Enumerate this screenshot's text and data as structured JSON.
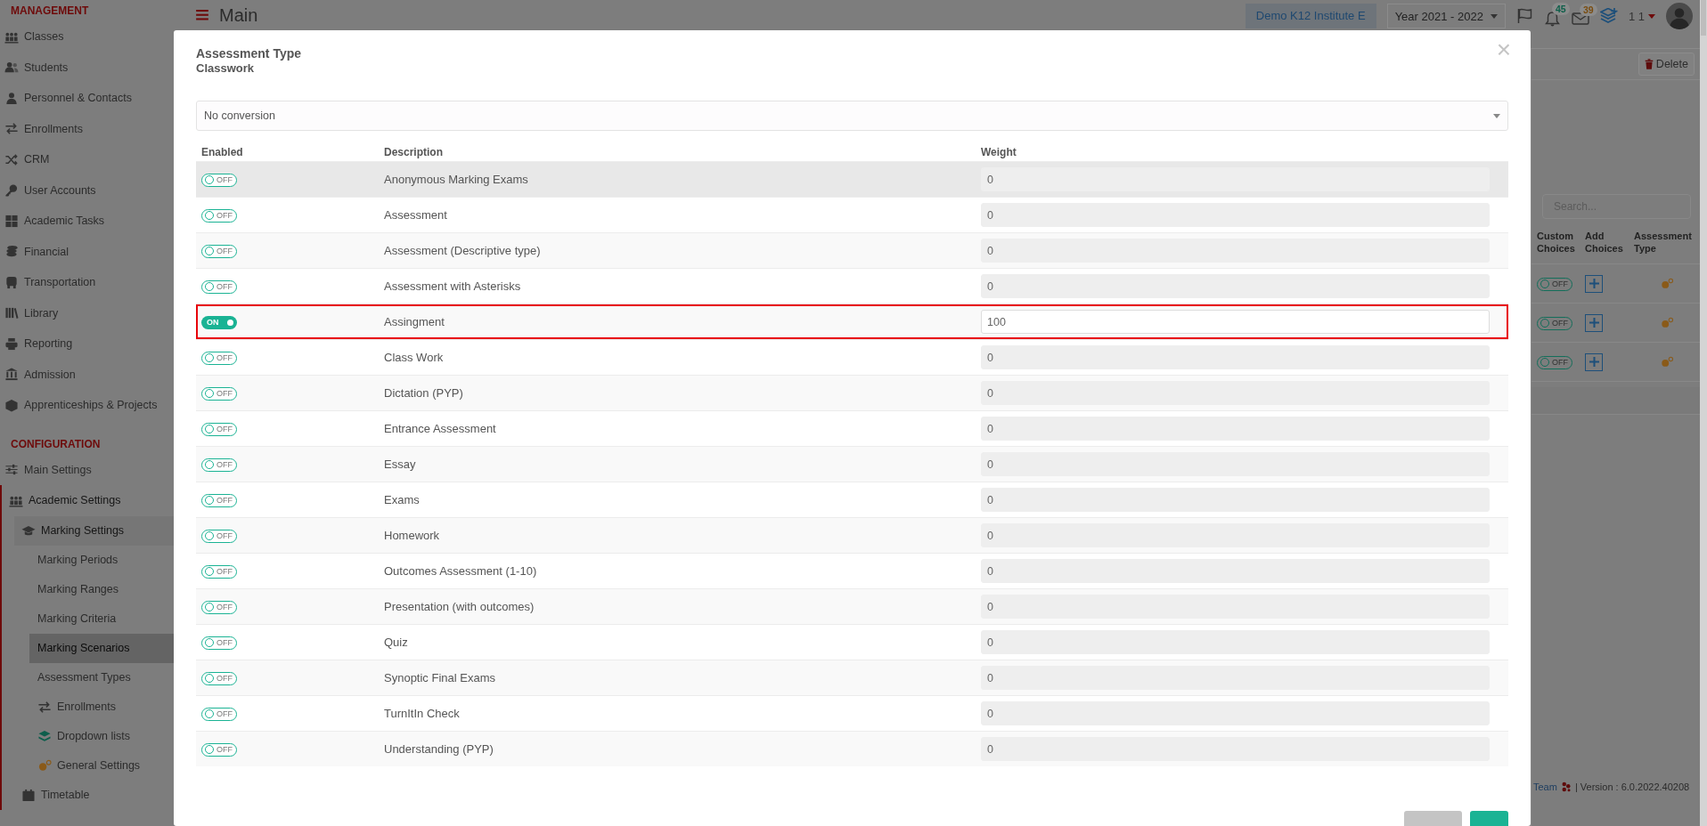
{
  "sidebar": {
    "sections": [
      {
        "title": "MANAGEMENT",
        "items": [
          {
            "label": "Classes",
            "kind": "people",
            "selected": false
          },
          {
            "label": "Students",
            "kind": "users",
            "selected": false
          },
          {
            "label": "Personnel & Contacts",
            "kind": "user",
            "selected": false
          },
          {
            "label": "Enrollments",
            "kind": "arrows",
            "selected": false
          },
          {
            "label": "CRM",
            "kind": "shuffle",
            "selected": false
          },
          {
            "label": "User Accounts",
            "kind": "key",
            "selected": false
          },
          {
            "label": "Academic Tasks",
            "kind": "grid",
            "selected": false
          },
          {
            "label": "Financial",
            "kind": "coins",
            "selected": false
          },
          {
            "label": "Transportation",
            "kind": "bus",
            "selected": false
          },
          {
            "label": "Library",
            "kind": "books",
            "selected": false
          },
          {
            "label": "Reporting",
            "kind": "printer",
            "selected": false
          },
          {
            "label": "Admission",
            "kind": "bank",
            "selected": false
          },
          {
            "label": "Apprenticeships & Projects",
            "kind": "cube",
            "selected": false
          }
        ]
      },
      {
        "title": "CONFIGURATION",
        "items": [
          {
            "label": "Main Settings",
            "kind": "sliders",
            "selected": false
          },
          {
            "label": "Academic Settings",
            "kind": "people",
            "selected": false,
            "expanded": true,
            "children": [
              {
                "label": "Marking Settings",
                "kind": "graduation-cap",
                "selected": false,
                "expanded": true,
                "children": [
                  {
                    "label": "Marking Periods",
                    "selected": false
                  },
                  {
                    "label": "Marking Ranges",
                    "selected": false
                  },
                  {
                    "label": "Marking Criteria",
                    "selected": false
                  },
                  {
                    "label": "Marking Scenarios",
                    "selected": true
                  },
                  {
                    "label": "Assessment Types",
                    "selected": false
                  },
                  {
                    "label": "Enrollments",
                    "kind": "arrows",
                    "selected": false
                  },
                  {
                    "label": "Dropdown lists",
                    "kind": "layers",
                    "selected": false
                  },
                  {
                    "label": "General Settings",
                    "kind": "gears",
                    "selected": false
                  }
                ]
              },
              {
                "label": "Timetable",
                "kind": "calendar",
                "selected": false
              }
            ]
          }
        ]
      }
    ]
  },
  "header": {
    "title": "Main",
    "institute": "Demo K12 Institute E",
    "year": "Year 2021 - 2022",
    "notifications": "45",
    "messages": "39",
    "user": "1 1"
  },
  "page": {
    "delete_button": "Delete",
    "search": {
      "placeholder": "Search..."
    },
    "columns": [
      "Custom Choices",
      "Add Choices",
      "Assessment Type"
    ],
    "rows": [
      {
        "on": false,
        "toggle_label": "OFF"
      },
      {
        "on": false,
        "toggle_label": "OFF"
      },
      {
        "on": false,
        "toggle_label": "OFF"
      }
    ]
  },
  "footer": {
    "link": "Team",
    "version": "| Version : 6.0.2022.40208"
  },
  "modal": {
    "title": "Assessment Type",
    "subtitle": "Classwork",
    "close": "×",
    "conversion": "No conversion",
    "columns": [
      "Enabled",
      "Description",
      "Weight"
    ],
    "rows": [
      {
        "on": false,
        "toggle_label": "OFF",
        "description": "Anonymous Marking Exams",
        "weight": "0",
        "hovered": true,
        "outlined": false
      },
      {
        "on": false,
        "toggle_label": "OFF",
        "description": "Assessment",
        "weight": "0",
        "hovered": false,
        "outlined": false
      },
      {
        "on": false,
        "toggle_label": "OFF",
        "description": "Assessment (Descriptive type)",
        "weight": "0",
        "hovered": false,
        "outlined": false
      },
      {
        "on": false,
        "toggle_label": "OFF",
        "description": "Assessment with Asterisks",
        "weight": "0",
        "hovered": false,
        "outlined": false
      },
      {
        "on": true,
        "toggle_label": "ON",
        "description": "Assingment",
        "weight": "100",
        "hovered": false,
        "outlined": true
      },
      {
        "on": false,
        "toggle_label": "OFF",
        "description": "Class Work",
        "weight": "0",
        "hovered": false,
        "outlined": false
      },
      {
        "on": false,
        "toggle_label": "OFF",
        "description": "Dictation (PYP)",
        "weight": "0",
        "hovered": false,
        "outlined": false
      },
      {
        "on": false,
        "toggle_label": "OFF",
        "description": "Entrance Assessment",
        "weight": "0",
        "hovered": false,
        "outlined": false
      },
      {
        "on": false,
        "toggle_label": "OFF",
        "description": "Essay",
        "weight": "0",
        "hovered": false,
        "outlined": false
      },
      {
        "on": false,
        "toggle_label": "OFF",
        "description": "Exams",
        "weight": "0",
        "hovered": false,
        "outlined": false
      },
      {
        "on": false,
        "toggle_label": "OFF",
        "description": "Homework",
        "weight": "0",
        "hovered": false,
        "outlined": false
      },
      {
        "on": false,
        "toggle_label": "OFF",
        "description": "Outcomes Assessment (1-10)",
        "weight": "0",
        "hovered": false,
        "outlined": false
      },
      {
        "on": false,
        "toggle_label": "OFF",
        "description": "Presentation (with outcomes)",
        "weight": "0",
        "hovered": false,
        "outlined": false
      },
      {
        "on": false,
        "toggle_label": "OFF",
        "description": "Quiz",
        "weight": "0",
        "hovered": false,
        "outlined": false
      },
      {
        "on": false,
        "toggle_label": "OFF",
        "description": "Synoptic Final Exams",
        "weight": "0",
        "hovered": false,
        "outlined": false
      },
      {
        "on": false,
        "toggle_label": "OFF",
        "description": "TurnItIn Check",
        "weight": "0",
        "hovered": false,
        "outlined": false
      },
      {
        "on": false,
        "toggle_label": "OFF",
        "description": "Understanding (PYP)",
        "weight": "0",
        "hovered": false,
        "outlined": false
      }
    ],
    "buttons": [
      {
        "kind": "secondary"
      },
      {
        "kind": "primary"
      }
    ]
  }
}
